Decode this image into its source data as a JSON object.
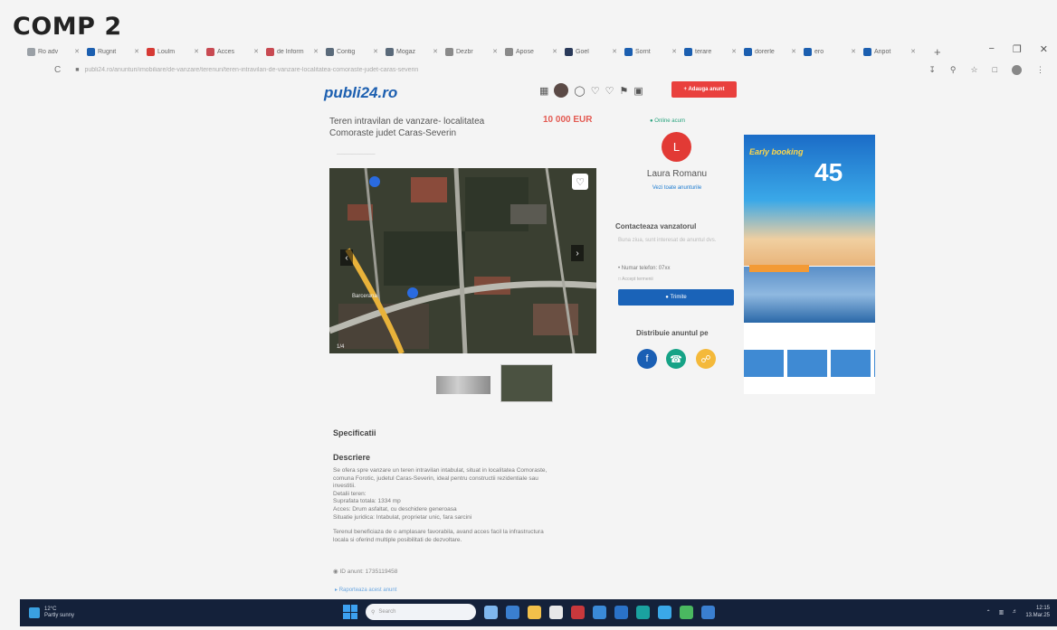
{
  "page_label": "COMP 2",
  "browser": {
    "tabs": [
      {
        "label": "Ro adv",
        "color": "#9aa0a6"
      },
      {
        "label": "Rugnit",
        "color": "#1c5fb0"
      },
      {
        "label": "Loulm",
        "color": "#d63a35"
      },
      {
        "label": "Acces",
        "color": "#c84a52"
      },
      {
        "label": "de Inform",
        "color": "#c84a52"
      },
      {
        "label": "Contig",
        "color": "#5a6a7a"
      },
      {
        "label": "Mogaz",
        "color": "#5a6a7a"
      },
      {
        "label": "Dezbr",
        "color": "#8a8a8a"
      },
      {
        "label": "Apose",
        "color": "#8a8a8a"
      },
      {
        "label": "Goel",
        "color": "#2a3a5a"
      },
      {
        "label": "Sornt",
        "color": "#1c5fb0"
      },
      {
        "label": "terare",
        "color": "#1c5fb0"
      },
      {
        "label": "dorerle",
        "color": "#1c5fb0"
      },
      {
        "label": "ero",
        "color": "#1c5fb0"
      },
      {
        "label": "Anpot",
        "color": "#1c5fb0"
      }
    ],
    "new_tab": "+",
    "window_controls": [
      "−",
      "❐",
      "✕"
    ],
    "reload": "C",
    "url": "publi24.ro/anunturi/imobiliare/de-vanzare/terenuri/teren-intravilan-de-vanzare-localitatea-comoraste-judet-caras-severin"
  },
  "site": {
    "logo": "publi24.ro",
    "add_ad": "+ Adauga anunt"
  },
  "listing": {
    "title": "Teren intravilan de vanzare- localitatea Comoraste judet Caras-Severin",
    "price": "10 000 EUR",
    "photo_count": "1/4",
    "map_label": "Barcerana"
  },
  "seller": {
    "status": "Online acum",
    "initial": "L",
    "name": "Laura Romanu",
    "link": "Vezi toate anunturile"
  },
  "contact": {
    "title": "Contacteaza vanzatorul",
    "placeholder": "Buna ziua, sunt interesat de anuntul dvs.",
    "phone": "Numar telefon: 07xx",
    "terms": "Accept termenii",
    "send": "Trimite"
  },
  "share": {
    "title": "Distribuie anuntul pe"
  },
  "banner": {
    "kicker": "Early booking",
    "percent": "45"
  },
  "specs_title": "Specificatii",
  "description": {
    "title": "Descriere",
    "lines": [
      "Se ofera spre vanzare un teren intravilan intabulat, situat in localitatea Comoraste,",
      "comuna Forotic, judetul Caras-Severin, ideal pentru constructii rezidentiale sau",
      "investitii.",
      "Detalii teren:",
      "Suprafata totala: 1334 mp",
      "Acces: Drum asfaltat, cu deschidere generoasa",
      "Situatie juridica: Intabulat, proprietar unic, fara sarcini",
      "",
      "Terenul beneficiaza de o amplasare favorabila, avand acces facil la infrastructura",
      "locala si oferind multiple posibilitati de dezvoltare."
    ],
    "ad_id": "ID anunt: 1735119458",
    "report": "Raporteaza acest anunt"
  },
  "taskbar": {
    "weather_temp": "12°C",
    "weather_desc": "Partly sunny",
    "search_placeholder": "Search",
    "time": "12:15",
    "date": "13.Mar.25",
    "apps": [
      "#7fb7ee",
      "#3a7fd0",
      "#f2c04a",
      "#e8e8e8",
      "#c8383c",
      "#3a8ad8",
      "#2a72c8",
      "#1aa2a0",
      "#3aa8e8",
      "#4ab860",
      "#3a7fd0"
    ]
  }
}
